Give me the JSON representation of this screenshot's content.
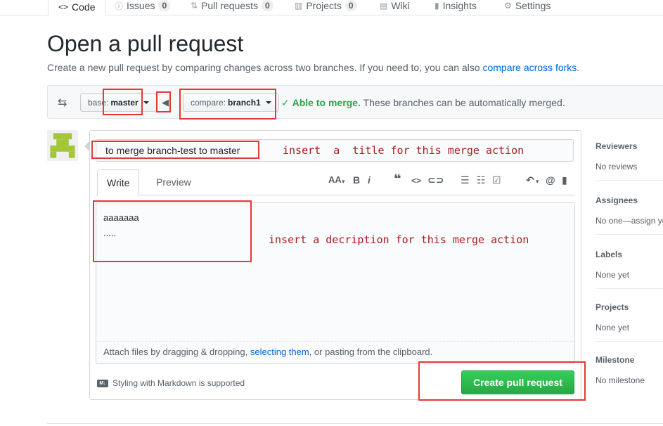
{
  "nav": {
    "tabs": [
      {
        "label": "Code",
        "icon": "code-icon",
        "counter": null
      },
      {
        "label": "Issues",
        "icon": "issue-icon",
        "counter": "0"
      },
      {
        "label": "Pull requests",
        "icon": "pull-request-icon",
        "counter": "0"
      },
      {
        "label": "Projects",
        "icon": "project-icon",
        "counter": "0"
      },
      {
        "label": "Wiki",
        "icon": "book-icon",
        "counter": null
      },
      {
        "label": "Insights",
        "icon": "graph-icon",
        "counter": null
      },
      {
        "label": "Settings",
        "icon": "gear-icon",
        "counter": null
      }
    ]
  },
  "header": {
    "title": "Open a pull request",
    "description": "Create a new pull request by comparing changes across two branches. If you need to, you can also ",
    "link": "compare across forks",
    "link_suffix": "."
  },
  "range": {
    "base_prefix": "base:",
    "base_branch": "master",
    "compare_prefix": "compare:",
    "compare_branch": "branch1",
    "status_ok": "Able to merge.",
    "status_text": "These branches can be automatically merged."
  },
  "form": {
    "title_value": "to merge branch-test to master",
    "tab_write": "Write",
    "tab_preview": "Preview",
    "body_line1": "aaaaaaa",
    "body_line2": ".....",
    "attach_prefix": "Attach files by dragging & dropping, ",
    "attach_link": "selecting them",
    "attach_suffix": ", or pasting from the clipboard.",
    "markdown_note": "Styling with Markdown is supported",
    "submit_label": "Create pull request"
  },
  "toolbar": {
    "header": "AA",
    "bold": "B",
    "italic": "i"
  },
  "sidebar": [
    {
      "heading": "Reviewers",
      "value": "No reviews"
    },
    {
      "heading": "Assignees",
      "value": "No one—assign yourself"
    },
    {
      "heading": "Labels",
      "value": "None yet"
    },
    {
      "heading": "Projects",
      "value": "None yet"
    },
    {
      "heading": "Milestone",
      "value": "No milestone"
    }
  ],
  "annotations": {
    "title_hint": "insert  a  title for this merge action",
    "body_hint": "insert a decription for this merge action"
  },
  "colors": {
    "accent_link": "#0366d6",
    "merge_ok": "#28a745",
    "button_green": "#2ea44f",
    "annotation_red": "#e53935"
  }
}
